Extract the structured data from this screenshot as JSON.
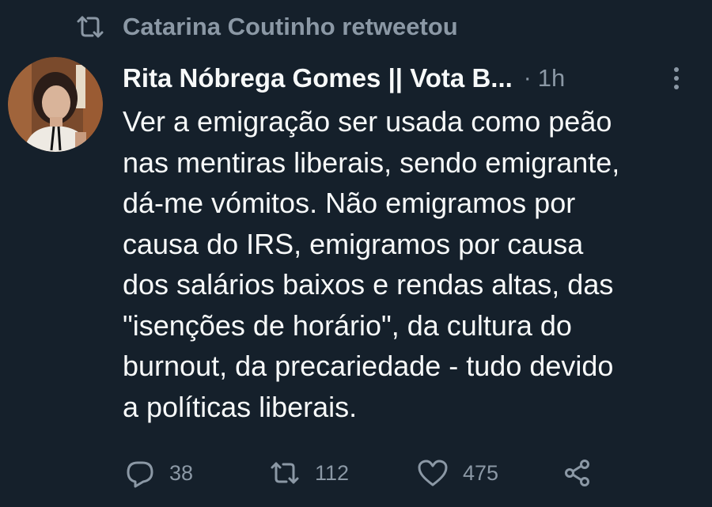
{
  "retweet_banner": {
    "icon": "retweet-icon",
    "text": "Catarina Coutinho retweetou"
  },
  "tweet": {
    "author_name": "Rita Nóbrega Gomes || Vota B...",
    "separator": "·",
    "time": "1h",
    "text": "Ver a emigração ser usada como peão\nnas mentiras liberais, sendo emigrante,\ndá-me vómitos. Não emigramos por\ncausa do IRS, emigramos por causa\ndos salários baixos e rendas altas, das\n\"isenções de horário\", da cultura do\nburnout, da precariedade - tudo devido\na políticas liberais."
  },
  "actions": {
    "reply_count": "38",
    "retweet_count": "112",
    "like_count": "475"
  },
  "colors": {
    "background": "#15202b",
    "text_primary": "#f7f9f9",
    "text_secondary": "#8b98a5"
  },
  "icons": [
    "retweet-icon",
    "more-icon",
    "reply-icon",
    "like-icon",
    "share-icon"
  ]
}
